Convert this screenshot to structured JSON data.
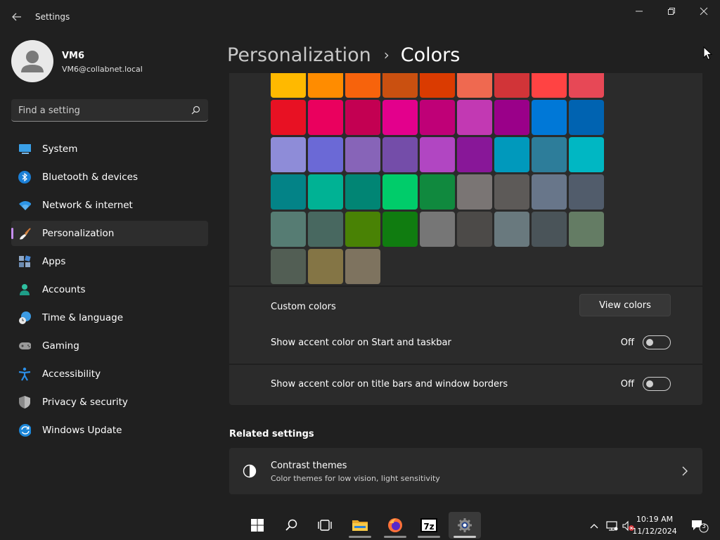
{
  "window": {
    "app_title": "Settings"
  },
  "profile": {
    "name": "VM6",
    "email": "VM6@collabnet.local"
  },
  "search": {
    "placeholder": "Find a setting"
  },
  "nav": {
    "items": [
      {
        "label": "System",
        "icon": "system-icon",
        "active": false
      },
      {
        "label": "Bluetooth & devices",
        "icon": "bluetooth-icon",
        "active": false
      },
      {
        "label": "Network & internet",
        "icon": "wifi-icon",
        "active": false
      },
      {
        "label": "Personalization",
        "icon": "brush-icon",
        "active": true
      },
      {
        "label": "Apps",
        "icon": "apps-icon",
        "active": false
      },
      {
        "label": "Accounts",
        "icon": "accounts-icon",
        "active": false
      },
      {
        "label": "Time & language",
        "icon": "time-language-icon",
        "active": false
      },
      {
        "label": "Gaming",
        "icon": "gamepad-icon",
        "active": false
      },
      {
        "label": "Accessibility",
        "icon": "accessibility-icon",
        "active": false
      },
      {
        "label": "Privacy & security",
        "icon": "shield-icon",
        "active": false
      },
      {
        "label": "Windows Update",
        "icon": "update-icon",
        "active": false
      }
    ]
  },
  "breadcrumb": {
    "parent": "Personalization",
    "separator": "›",
    "current": "Colors"
  },
  "accent_colors": {
    "rows": [
      [
        "#FFB900",
        "#FF8C00",
        "#F7630C",
        "#CA5010",
        "#DA3B01",
        "#EF6950",
        "#D13438",
        "#FF4343",
        "#E74856"
      ],
      [
        "#E81123",
        "#EA005E",
        "#C30052",
        "#E3008C",
        "#BF0077",
        "#C239B3",
        "#9A0089",
        "#0078D7",
        "#0063B1"
      ],
      [
        "#8E8CD8",
        "#6B69D6",
        "#8764B8",
        "#744DA9",
        "#B146C2",
        "#881798",
        "#0099BC",
        "#2D7D9A",
        "#00B7C3"
      ],
      [
        "#038387",
        "#00B294",
        "#018574",
        "#00CC6A",
        "#10893E",
        "#7A7574",
        "#5D5A58",
        "#68768A",
        "#515C6B"
      ],
      [
        "#567C73",
        "#486860",
        "#498205",
        "#107C10",
        "#767676",
        "#4C4A48",
        "#69797E",
        "#4A5459",
        "#647C64"
      ],
      [
        "#525E54",
        "#847545",
        "#7E735F"
      ]
    ]
  },
  "custom_colors": {
    "label": "Custom colors",
    "button_label": "View colors"
  },
  "accent_start": {
    "label": "Show accent color on Start and taskbar",
    "state": "Off"
  },
  "accent_titlebars": {
    "label": "Show accent color on title bars and window borders",
    "state": "Off"
  },
  "related": {
    "heading": "Related settings",
    "items": [
      {
        "title": "Contrast themes",
        "subtitle": "Color themes for low vision, light sensitivity",
        "icon": "contrast-icon"
      }
    ]
  },
  "taskbar": {
    "apps": [
      {
        "name": "start-button",
        "icon": "windows-logo-icon"
      },
      {
        "name": "search-button",
        "icon": "search-icon"
      },
      {
        "name": "task-view-button",
        "icon": "task-view-icon"
      },
      {
        "name": "file-explorer-button",
        "icon": "folder-icon"
      },
      {
        "name": "firefox-button",
        "icon": "firefox-icon"
      },
      {
        "name": "7zip-button",
        "icon": "7zip-icon",
        "text": "7z"
      },
      {
        "name": "settings-button",
        "icon": "gear-icon"
      }
    ],
    "time": "10:19 AM",
    "date": "11/12/2024",
    "notification_count": "3"
  }
}
